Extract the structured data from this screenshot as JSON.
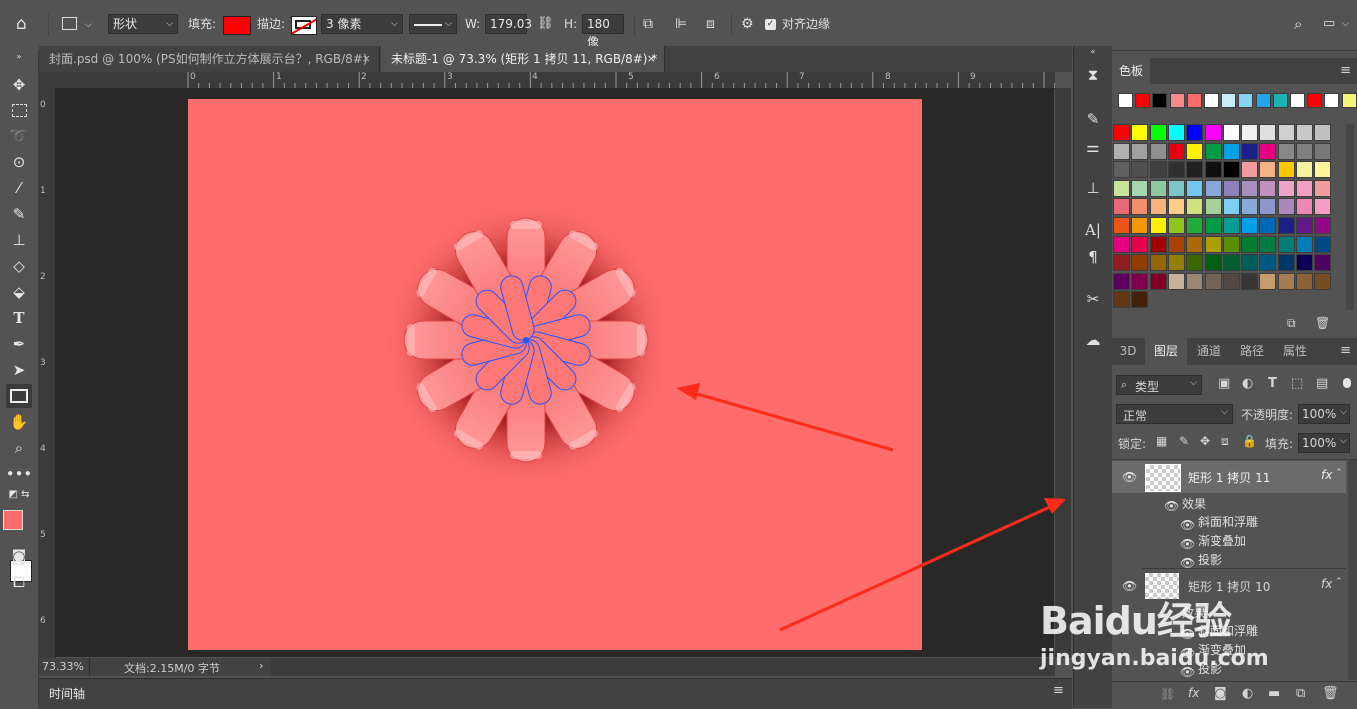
{
  "options_bar": {
    "mode_label": "形状",
    "fill_label": "填充:",
    "fill_color": "#ff0000",
    "stroke_label": "描边:",
    "stroke_width": "3 像素",
    "w_label": "W:",
    "w_value": "179.03",
    "h_label": "H:",
    "h_value": "180 像",
    "align_edges_label": "对齐边缘"
  },
  "tabs": [
    {
      "label": "封面.psd @ 100% (PS如何制作立方体展示台？, RGB/8#)",
      "close": "×"
    },
    {
      "label": "未标题-1 @ 73.3% (矩形 1 拷贝 11, RGB/8#) *",
      "close": "×"
    }
  ],
  "ruler_top": [
    "0",
    "1",
    "2",
    "3",
    "4",
    "5",
    "6",
    "7",
    "8",
    "9"
  ],
  "ruler_left": [
    "0",
    "1",
    "2",
    "3",
    "4",
    "5",
    "6"
  ],
  "status": {
    "zoom": "73.33%",
    "doc_info": "文档:2.15M/0 字节",
    "arrow": "›"
  },
  "timeline_label": "时间轴",
  "swatches": {
    "tab_label": "色板",
    "recent": [
      "#ffffff",
      "#ff0000",
      "#000000",
      "#f58a8a",
      "#fe6c6c",
      "#ffffff",
      "#c9edf7",
      "#86d3f2",
      "#23a6e8",
      "#1ab3b0",
      "#ffffff",
      "#ff0000",
      "#ffffff",
      "#f5f57a"
    ],
    "grid": [
      [
        "#ff0000",
        "#ffff00",
        "#00ff00",
        "#00ffff",
        "#0000ff",
        "#ff00ff",
        "#ffffff",
        "#f0f0f0",
        "#e0e0e0",
        "#d0d0d0",
        "#c8c8c8",
        "#c0c0c0"
      ],
      [
        "#b0b0b0",
        "#a0a0a0",
        "#909090",
        "#e60012",
        "#fff100",
        "#009944",
        "#00a0e9",
        "#1d2088",
        "#e4007f",
        "#888888",
        "#808080",
        "#787878"
      ],
      [
        "#606060",
        "#505050",
        "#404040",
        "#303030",
        "#202020",
        "#101010",
        "#000000",
        "#f29c9f",
        "#f5b283",
        "#fcc800",
        "#f6f3a0",
        "#fff799"
      ],
      [
        "#c9e39c",
        "#a5d4ae",
        "#8fc7a1",
        "#7bc6c8",
        "#73c6ed",
        "#89a6d8",
        "#8f82bc",
        "#a98fc0",
        "#c490bf",
        "#eea3c8",
        "#f19ec2",
        "#f29c9f"
      ],
      [
        "#eb6877",
        "#f08f6a",
        "#f6b37f",
        "#facd89",
        "#d0e17d",
        "#a5d196",
        "#7ecef4",
        "#88abda",
        "#8c97cb",
        "#aa89bd",
        "#ee87b4",
        "#f19ec2"
      ],
      [
        "#ea5514",
        "#f39800",
        "#fff100",
        "#8fc31f",
        "#22ac38",
        "#009944",
        "#009e96",
        "#00a0e9",
        "#0068b7",
        "#1d2088",
        "#601986",
        "#920783"
      ],
      [
        "#e4007f",
        "#e5004f",
        "#a40000",
        "#a84200",
        "#ac6a00",
        "#ad9e00",
        "#5b8d00",
        "#007d31",
        "#007b43",
        "#007c76",
        "#007db6",
        "#004986"
      ],
      [
        "#8e1e20",
        "#8f3d00",
        "#946600",
        "#947f00",
        "#3a6600",
        "#005e15",
        "#005f32",
        "#005e5a",
        "#005982",
        "#003567",
        "#0f0057",
        "#4f0261"
      ],
      [
        "#5d0060",
        "#80004d",
        "#7f0024",
        "#c7b299",
        "#998675",
        "#736357",
        "#534741",
        "#363636",
        "#c69c6d",
        "#a67c52",
        "#8c6239",
        "#754c24"
      ],
      [
        "#603813",
        "#42210b"
      ]
    ],
    "new_icon": "new-swatch-icon",
    "trash_icon": "trash-icon"
  },
  "layers": {
    "tabs": [
      "3D",
      "图层",
      "通道",
      "路径",
      "属性"
    ],
    "filter_label": "类型",
    "blend_mode": "正常",
    "opacity_label": "不透明度:",
    "opacity_value": "100%",
    "lock_label": "锁定:",
    "fill_label": "填充:",
    "fill_value": "100%",
    "items": [
      {
        "name": "矩形 1 拷贝 11",
        "fx": "fx",
        "effects_label": "效果",
        "effects": [
          "斜面和浮雕",
          "渐变叠加",
          "投影"
        ]
      },
      {
        "name": "矩形 1 拷贝 10",
        "fx": "fx",
        "effects_label": "效果",
        "effects": [
          "斜面和浮雕",
          "渐变叠加",
          "投影"
        ]
      }
    ]
  },
  "watermark": {
    "brand": "Baidu经验",
    "url": "jingyan.baidu.com"
  },
  "colors": {
    "canvas_fill": "#fe6c6c",
    "arrow": "#ff2a1a",
    "foreground": "#fe6c6c",
    "background": "#ffffff"
  }
}
